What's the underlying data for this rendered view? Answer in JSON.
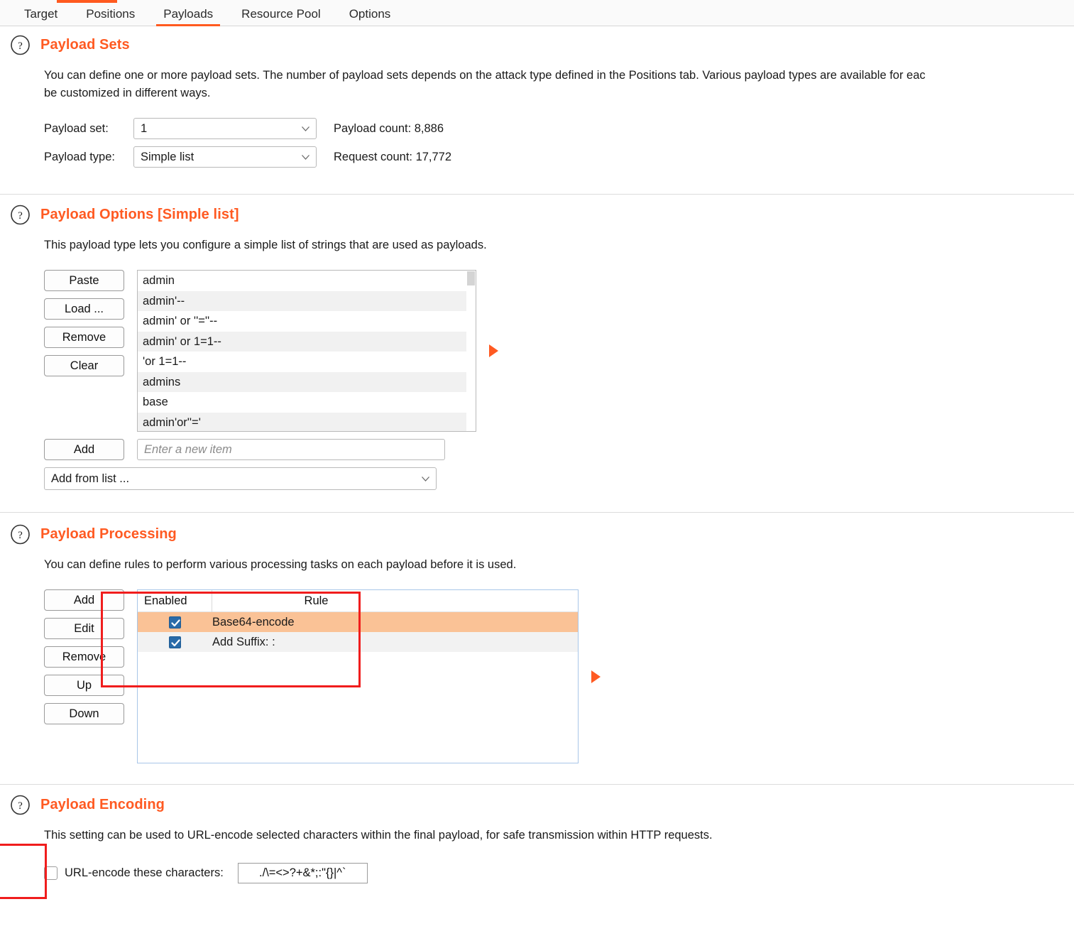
{
  "tabs": [
    {
      "label": "Target",
      "active": false
    },
    {
      "label": "Positions",
      "active": false
    },
    {
      "label": "Payloads",
      "active": true
    },
    {
      "label": "Resource Pool",
      "active": false
    },
    {
      "label": "Options",
      "active": false
    }
  ],
  "colors": {
    "accent_orange": "#ff5a22",
    "tab_indicator": "#ff5a1f",
    "selected_row": "#fac296",
    "checkbox_blue": "#2a6ba8",
    "highlight_red": "#f01d1d",
    "panel_border_blue": "#a8c6e8"
  },
  "payload_sets": {
    "title": "Payload Sets",
    "help_icon": "question-mark-icon",
    "description": "You can define one or more payload sets. The number of payload sets depends on the attack type defined in the Positions tab. Various payload types are available for eac",
    "payload_set_label": "Payload set:",
    "payload_set_value": "1",
    "payload_type_label": "Payload type:",
    "payload_type_value": "Simple list",
    "payload_count_label": "Payload count:  8,886",
    "request_count_label": "Request count:  17,772"
  },
  "payload_options": {
    "title": "Payload Options [Simple list]",
    "help_icon": "question-mark-icon",
    "description": "This payload type lets you configure a simple list of strings that are used as payloads.",
    "buttons": [
      {
        "label": "Paste"
      },
      {
        "label": "Load ..."
      },
      {
        "label": "Remove"
      },
      {
        "label": "Clear"
      }
    ],
    "items": [
      "admin",
      "admin'--",
      "admin' or ''=''--",
      "admin' or 1=1--",
      "'or 1=1--",
      "admins",
      "base",
      "admin'or''='"
    ],
    "add_button": "Add",
    "new_item_placeholder": "Enter a new item",
    "new_item_value": "",
    "add_from_list": "Add from list ...",
    "marker_icon": "orange-triangle-icon"
  },
  "payload_processing": {
    "title": "Payload Processing",
    "help_icon": "question-mark-icon",
    "description": "You can define rules to perform various processing tasks on each payload before it is used.",
    "buttons": [
      {
        "label": "Add"
      },
      {
        "label": "Edit"
      },
      {
        "label": "Remove"
      },
      {
        "label": "Up"
      },
      {
        "label": "Down"
      }
    ],
    "columns": [
      "Enabled",
      "Rule"
    ],
    "rules": [
      {
        "enabled": true,
        "rule": "Base64-encode",
        "selected": true
      },
      {
        "enabled": true,
        "rule": "Add Suffix: :",
        "selected": false
      }
    ],
    "marker_icon": "orange-triangle-icon"
  },
  "payload_encoding": {
    "title": "Payload Encoding",
    "help_icon": "question-mark-icon",
    "description": "This setting can be used to URL-encode selected characters within the final payload, for safe transmission within HTTP requests.",
    "checkbox_label": "URL-encode these characters:",
    "checkbox_checked": false,
    "characters_value": "./\\=<>?+&*;:\"{}|^`"
  }
}
